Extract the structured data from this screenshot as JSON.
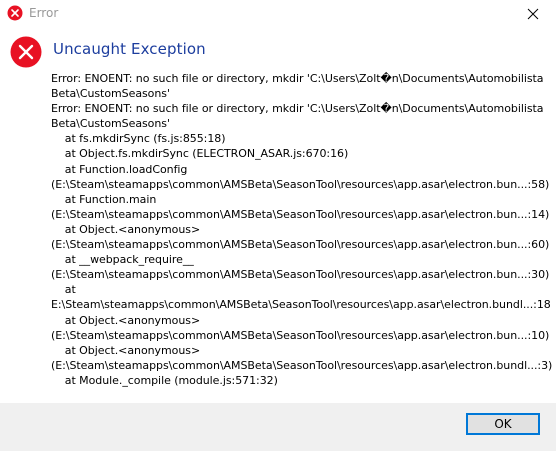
{
  "window": {
    "title": "Error",
    "accent_color": "#1c3d9e",
    "error_color": "#e81123",
    "button_border_color": "#0078d7"
  },
  "dialog": {
    "heading": "Uncaught Exception",
    "message_lines": [
      "Error: ENOENT: no such file or directory, mkdir 'C:\\Users\\Zolt�n\\Documents\\Automobilista",
      "Beta\\CustomSeasons'",
      "Error: ENOENT: no such file or directory, mkdir 'C:\\Users\\Zolt�n\\Documents\\Automobilista",
      "Beta\\CustomSeasons'",
      "    at fs.mkdirSync (fs.js:855:18)",
      "    at Object.fs.mkdirSync (ELECTRON_ASAR.js:670:16)",
      "    at Function.loadConfig",
      "(E:\\Steam\\steamapps\\common\\AMSBeta\\SeasonTool\\resources\\app.asar\\electron.bun...:58)",
      "    at Function.main",
      "(E:\\Steam\\steamapps\\common\\AMSBeta\\SeasonTool\\resources\\app.asar\\electron.bun...:14)",
      "    at Object.<anonymous>",
      "(E:\\Steam\\steamapps\\common\\AMSBeta\\SeasonTool\\resources\\app.asar\\electron.bun...:60)",
      "    at __webpack_require__",
      "(E:\\Steam\\steamapps\\common\\AMSBeta\\SeasonTool\\resources\\app.asar\\electron.bun...:30)",
      "    at",
      "E:\\Steam\\steamapps\\common\\AMSBeta\\SeasonTool\\resources\\app.asar\\electron.bundl...:18",
      "    at Object.<anonymous>",
      "(E:\\Steam\\steamapps\\common\\AMSBeta\\SeasonTool\\resources\\app.asar\\electron.bun...:10)",
      "    at Object.<anonymous>",
      "(E:\\Steam\\steamapps\\common\\AMSBeta\\SeasonTool\\resources\\app.asar\\electron.bundl...:3)",
      "    at Module._compile (module.js:571:32)"
    ]
  },
  "buttons": {
    "ok_label": "OK"
  }
}
